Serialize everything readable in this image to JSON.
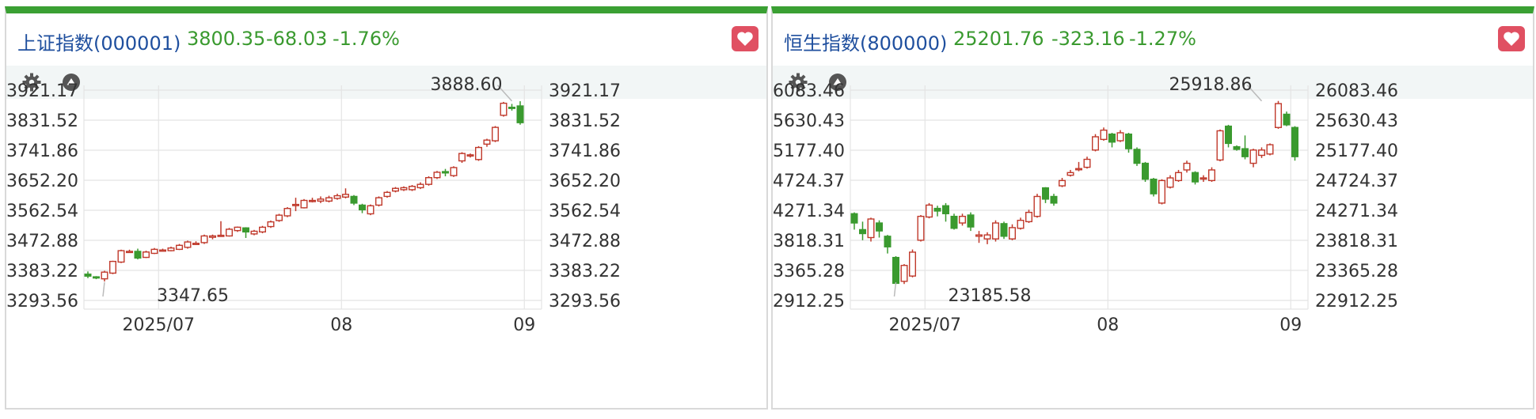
{
  "panels": [
    {
      "id": "sse",
      "title": "上证指数(000001)",
      "price": "3800.35",
      "change": "-68.03",
      "change_pct": "-1.76%"
    },
    {
      "id": "hsi",
      "title": "恒生指数(800000)",
      "price": "25201.76",
      "change": "-323.16",
      "change_pct": "-1.27%"
    }
  ],
  "colors": {
    "up": "#c0392b",
    "down": "#3a9a2f",
    "accent": "#3aa033",
    "title": "#1f4f9e"
  },
  "icons": [
    "heart-icon",
    "gear-icon",
    "triangle-up-icon"
  ],
  "chart_data": [
    {
      "type": "candlestick",
      "x_tick_labels": [
        "2025/07",
        "08",
        "09"
      ],
      "y_tick_labels": [
        "3921.17",
        "3831.52",
        "3741.86",
        "3652.20",
        "3562.54",
        "3472.88",
        "3383.22",
        "3293.56"
      ],
      "ylim": [
        3293.56,
        3921.17
      ],
      "grid": true,
      "annotations": [
        {
          "text": "3888.60",
          "index": 51,
          "value": 3888.6
        },
        {
          "text": "3347.65",
          "index": 2,
          "value": 3347.65
        }
      ],
      "month_boundaries": {
        "2025/07": 8.5,
        "08": 30.5,
        "09": 52.5
      },
      "candles": [
        [
          3372,
          3366,
          3380,
          3360
        ],
        [
          3364,
          3362,
          3366,
          3357
        ],
        [
          3358,
          3378,
          3382,
          3350
        ],
        [
          3375,
          3410,
          3412,
          3372
        ],
        [
          3408,
          3442,
          3445,
          3405
        ],
        [
          3440,
          3440,
          3445,
          3436
        ],
        [
          3440,
          3420,
          3448,
          3416
        ],
        [
          3422,
          3438,
          3442,
          3420
        ],
        [
          3434,
          3446,
          3450,
          3432
        ],
        [
          3444,
          3444,
          3448,
          3440
        ],
        [
          3442,
          3450,
          3454,
          3440
        ],
        [
          3446,
          3458,
          3462,
          3444
        ],
        [
          3452,
          3468,
          3472,
          3448
        ],
        [
          3464,
          3464,
          3470,
          3460
        ],
        [
          3466,
          3486,
          3490,
          3462
        ],
        [
          3482,
          3486,
          3490,
          3476
        ],
        [
          3486,
          3488,
          3530,
          3484
        ],
        [
          3486,
          3506,
          3510,
          3484
        ],
        [
          3502,
          3512,
          3514,
          3498
        ],
        [
          3510,
          3498,
          3512,
          3480
        ],
        [
          3492,
          3500,
          3504,
          3488
        ],
        [
          3498,
          3512,
          3516,
          3494
        ],
        [
          3514,
          3528,
          3532,
          3510
        ],
        [
          3532,
          3548,
          3552,
          3528
        ],
        [
          3546,
          3568,
          3572,
          3542
        ],
        [
          3580,
          3580,
          3600,
          3560
        ],
        [
          3570,
          3592,
          3596,
          3568
        ],
        [
          3592,
          3592,
          3600,
          3586
        ],
        [
          3590,
          3596,
          3604,
          3584
        ],
        [
          3590,
          3600,
          3606,
          3586
        ],
        [
          3598,
          3606,
          3612,
          3594
        ],
        [
          3602,
          3610,
          3628,
          3598
        ],
        [
          3604,
          3584,
          3608,
          3578
        ],
        [
          3578,
          3564,
          3582,
          3554
        ],
        [
          3552,
          3576,
          3580,
          3548
        ],
        [
          3578,
          3600,
          3604,
          3574
        ],
        [
          3604,
          3616,
          3620,
          3600
        ],
        [
          3620,
          3628,
          3632,
          3616
        ],
        [
          3624,
          3630,
          3634,
          3620
        ],
        [
          3624,
          3634,
          3638,
          3620
        ],
        [
          3630,
          3640,
          3646,
          3626
        ],
        [
          3640,
          3660,
          3664,
          3636
        ],
        [
          3660,
          3676,
          3680,
          3656
        ],
        [
          3678,
          3674,
          3686,
          3664
        ],
        [
          3666,
          3690,
          3694,
          3662
        ],
        [
          3710,
          3732,
          3736,
          3704
        ],
        [
          3728,
          3728,
          3732,
          3720
        ],
        [
          3714,
          3750,
          3754,
          3710
        ],
        [
          3760,
          3772,
          3776,
          3752
        ],
        [
          3770,
          3810,
          3814,
          3766
        ],
        [
          3846,
          3882,
          3886,
          3842
        ],
        [
          3870,
          3868,
          3880,
          3860
        ],
        [
          3874,
          3824,
          3888,
          3818
        ]
      ]
    },
    {
      "type": "candlestick",
      "x_tick_labels": [
        "2025/07",
        "08",
        "09"
      ],
      "y_tick_labels": [
        "26083.46",
        "25630.43",
        "25177.40",
        "24724.37",
        "24271.34",
        "23818.31",
        "23365.28",
        "22912.25"
      ],
      "ylim": [
        22912.25,
        26083.46
      ],
      "grid": true,
      "annotations": [
        {
          "text": "25918.86",
          "index": 49,
          "value": 25918.86
        },
        {
          "text": "23185.58",
          "index": 5,
          "value": 23185.58
        }
      ],
      "month_boundaries": {
        "2025/07": 8.5,
        "08": 30.5,
        "09": 52.5
      },
      "candles": [
        [
          24220,
          24080,
          24240,
          23980
        ],
        [
          23980,
          23920,
          24100,
          23820
        ],
        [
          23860,
          24140,
          24160,
          23800
        ],
        [
          24080,
          23960,
          24120,
          23860
        ],
        [
          23880,
          23720,
          23900,
          23620
        ],
        [
          23560,
          23170,
          23580,
          23160
        ],
        [
          23200,
          23440,
          23460,
          23160
        ],
        [
          23280,
          23640,
          23680,
          23260
        ],
        [
          23820,
          24180,
          24200,
          23800
        ],
        [
          24170,
          24350,
          24380,
          24150
        ],
        [
          24300,
          24260,
          24340,
          24180
        ],
        [
          24340,
          24220,
          24380,
          24100
        ],
        [
          24180,
          24000,
          24220,
          23980
        ],
        [
          24080,
          24180,
          24220,
          24040
        ],
        [
          24200,
          24020,
          24240,
          23960
        ],
        [
          23880,
          23900,
          23960,
          23780
        ],
        [
          23840,
          23900,
          23940,
          23760
        ],
        [
          23840,
          24080,
          24120,
          23800
        ],
        [
          24070,
          23880,
          24100,
          23840
        ],
        [
          23840,
          24010,
          24060,
          23820
        ],
        [
          24000,
          24120,
          24160,
          23980
        ],
        [
          24100,
          24240,
          24280,
          24080
        ],
        [
          24180,
          24480,
          24520,
          24160
        ],
        [
          24610,
          24440,
          24620,
          24380
        ],
        [
          24480,
          24380,
          24520,
          24340
        ],
        [
          24640,
          24720,
          24760,
          24620
        ],
        [
          24800,
          24840,
          24880,
          24780
        ],
        [
          24900,
          24900,
          25000,
          24860
        ],
        [
          24920,
          25040,
          25080,
          24900
        ],
        [
          25180,
          25380,
          25420,
          25160
        ],
        [
          25340,
          25480,
          25520,
          25320
        ],
        [
          25420,
          25300,
          25440,
          25220
        ],
        [
          25320,
          25440,
          25480,
          25300
        ],
        [
          25420,
          25200,
          25440,
          25140
        ],
        [
          25190,
          24980,
          25220,
          24940
        ],
        [
          24980,
          24740,
          25000,
          24700
        ],
        [
          24740,
          24520,
          24760,
          24480
        ],
        [
          24380,
          24720,
          24740,
          24360
        ],
        [
          24620,
          24760,
          24800,
          24600
        ],
        [
          24720,
          24840,
          24880,
          24700
        ],
        [
          24880,
          24980,
          25020,
          24840
        ],
        [
          24840,
          24700,
          24860,
          24660
        ],
        [
          24760,
          24760,
          24800,
          24700
        ],
        [
          24720,
          24880,
          24920,
          24700
        ],
        [
          25030,
          25470,
          25490,
          25010
        ],
        [
          25540,
          25280,
          25560,
          25220
        ],
        [
          25230,
          25190,
          25250,
          25170
        ],
        [
          25200,
          25080,
          25400,
          25040
        ],
        [
          24980,
          25180,
          25200,
          24920
        ],
        [
          25100,
          25180,
          25220,
          25060
        ],
        [
          25120,
          25260,
          25280,
          25100
        ],
        [
          25520,
          25880,
          25920,
          25500
        ],
        [
          25720,
          25560,
          25760,
          25540
        ],
        [
          25520,
          25080,
          25540,
          25020
        ]
      ]
    }
  ]
}
